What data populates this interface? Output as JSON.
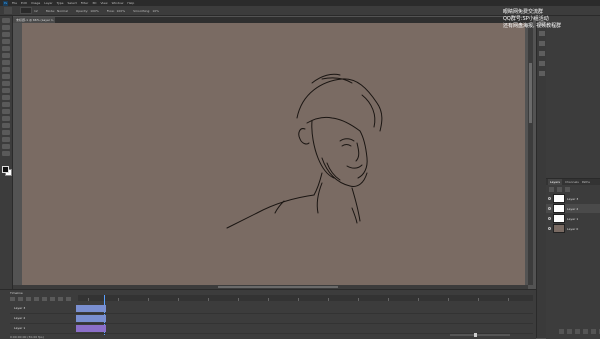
{
  "menubar": {
    "logo": "Ps",
    "items": [
      "File",
      "Edit",
      "Image",
      "Layer",
      "Type",
      "Select",
      "Filter",
      "3D",
      "View",
      "Window",
      "Help"
    ]
  },
  "options_bar": {
    "size": "12",
    "mode_label": "Mode:",
    "mode_value": "Normal",
    "opacity_label": "Opacity:",
    "opacity_value": "100%",
    "flow_label": "Flow:",
    "flow_value": "100%",
    "smoothing_label": "Smoothing:",
    "smoothing_value": "10%"
  },
  "document": {
    "tab_label": "未标题-1 @ 66% (Layer 1, RGB/8)"
  },
  "colors": {
    "canvas_bg": "#7a6b63",
    "app_bg": "#535353",
    "panel_bg": "#3c3c3c",
    "track_blue": "#7a8fd1",
    "track_purple": "#8b6fc9",
    "accent": "#5aa0ff"
  },
  "watermark": {
    "line1": "眼睛网免费交流群",
    "line2": "QQ群号:SP小组活动",
    "line3": "还有网盘海报, 视频教程群"
  },
  "layers_panel": {
    "tabs": [
      "Layers",
      "Channels",
      "Paths"
    ],
    "layers": [
      {
        "name": "Layer 3",
        "thumb": "white",
        "selected": false
      },
      {
        "name": "Layer 2",
        "thumb": "white",
        "selected": true
      },
      {
        "name": "Layer 1",
        "thumb": "white",
        "selected": false
      },
      {
        "name": "Layer 0",
        "thumb": "brown",
        "selected": false
      }
    ]
  },
  "timeline": {
    "title": "Timeline",
    "tracks": [
      {
        "name": "Layer 3",
        "color": "#7a8fd1",
        "clip": "Layer 3"
      },
      {
        "name": "Layer 2",
        "color": "#7a8fd1",
        "clip": "Layer 2"
      },
      {
        "name": "Layer 1",
        "color": "#8b6fc9",
        "clip": "Layer 1"
      }
    ],
    "timecode": "0:00:00:00",
    "fps": "(30.00 fps)"
  }
}
